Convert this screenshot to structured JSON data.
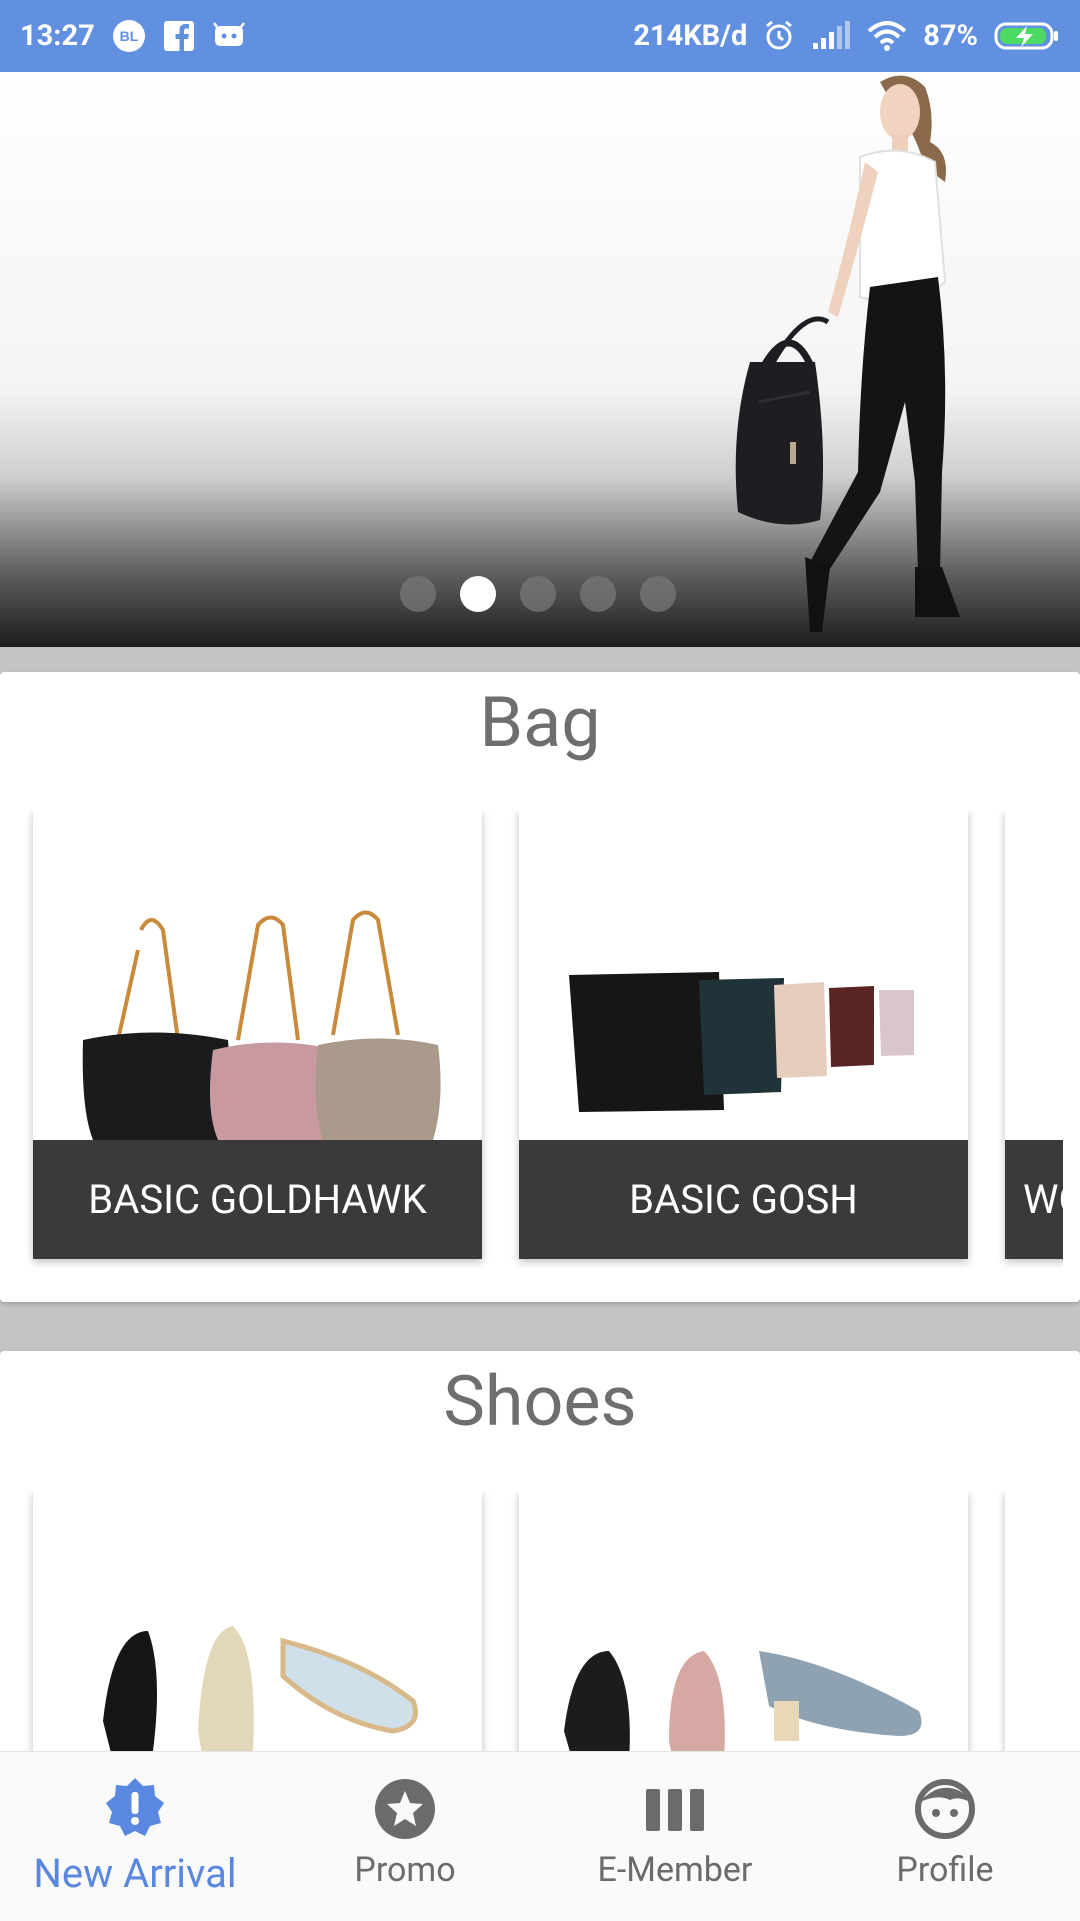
{
  "status_bar": {
    "time": "13:27",
    "network_speed": "214KB/d",
    "battery": "87%",
    "icons": [
      "bl-icon",
      "facebook-icon",
      "game-icon",
      "alarm-icon",
      "signal-icon",
      "wifi-icon",
      "battery-charging-icon"
    ],
    "bg_color": "#6190e0"
  },
  "hero": {
    "slides": 5,
    "active_index": 1
  },
  "sections": [
    {
      "title": "Bag",
      "cards": [
        {
          "label": "BASIC GOLDHAWK"
        },
        {
          "label": "BASIC GOSH"
        },
        {
          "label": "WO"
        }
      ]
    },
    {
      "title": "Shoes",
      "cards": [
        {
          "label": ""
        },
        {
          "label": ""
        },
        {
          "label": ""
        }
      ]
    }
  ],
  "bottom_nav": {
    "active_color": "#5a88e0",
    "items": [
      {
        "label": "New Arrival",
        "icon": "alert-badge-icon",
        "active": true
      },
      {
        "label": "Promo",
        "icon": "star-circle-icon",
        "active": false
      },
      {
        "label": "E-Member",
        "icon": "member-bars-icon",
        "active": false
      },
      {
        "label": "Profile",
        "icon": "face-icon",
        "active": false
      }
    ]
  }
}
